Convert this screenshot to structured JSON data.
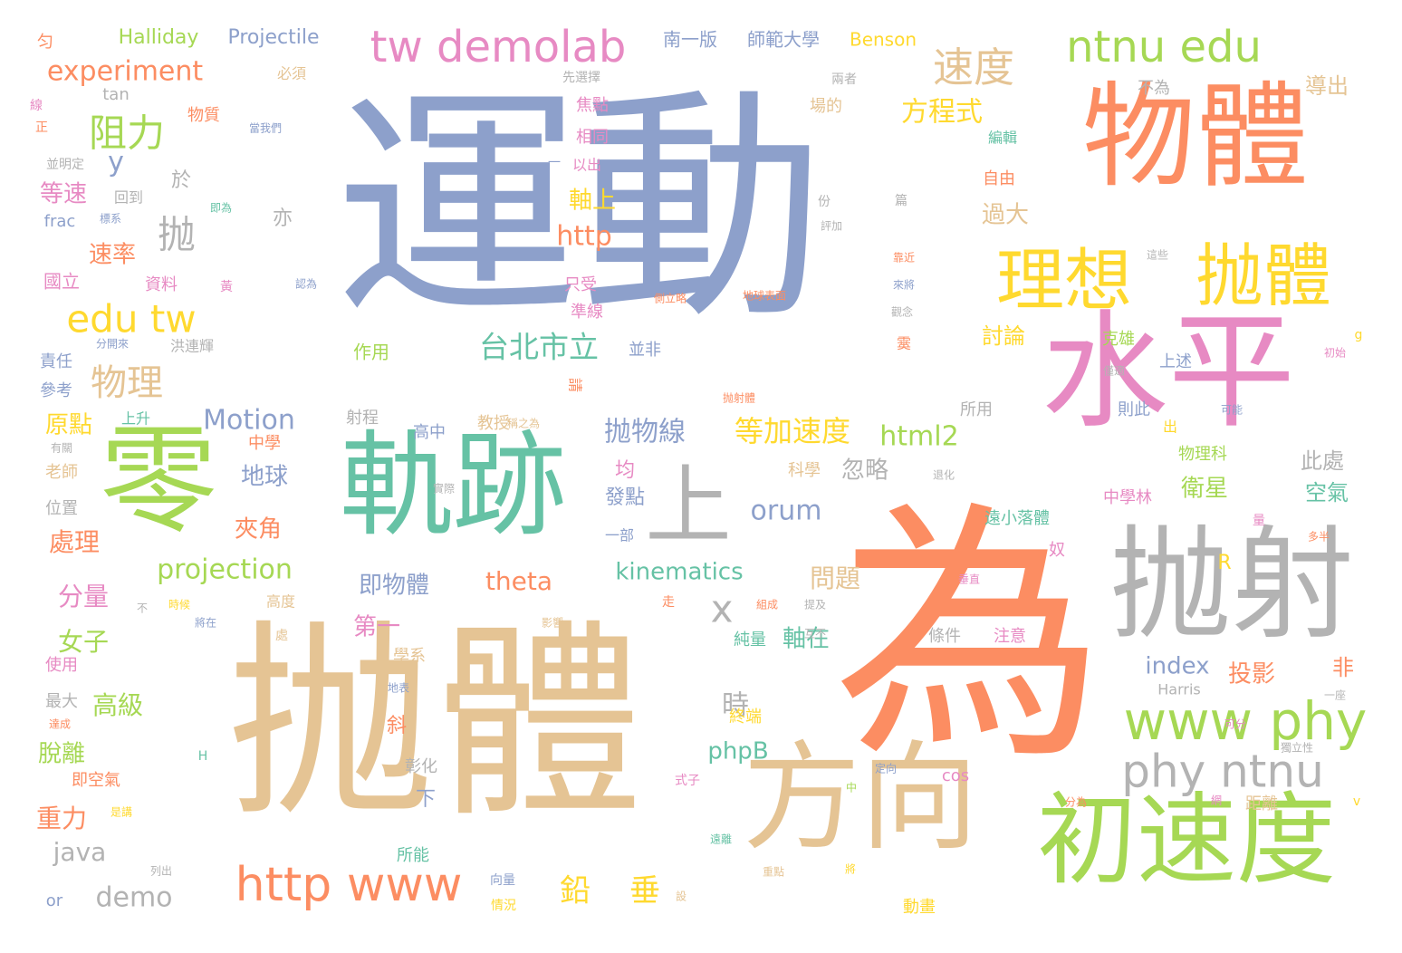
{
  "palette": {
    "blue": "#8da0cb",
    "orange": "#fc8d62",
    "tan": "#e5c494",
    "green": "#a6d854",
    "teal": "#66c2a5",
    "pink": "#e78ac3",
    "yellow": "#ffd92f",
    "gray": "#b3b3b3"
  },
  "words": [
    {
      "text": "運動",
      "color": "blue"
    },
    {
      "text": "為",
      "color": "orange"
    },
    {
      "text": "抛體",
      "color": "tan"
    },
    {
      "text": "物體",
      "color": "orange"
    },
    {
      "text": "水平",
      "color": "pink"
    },
    {
      "text": "軌跡",
      "color": "teal"
    },
    {
      "text": "零",
      "color": "green"
    },
    {
      "text": "抛射",
      "color": "gray"
    },
    {
      "text": "上",
      "color": "gray"
    },
    {
      "text": "方向",
      "color": "tan"
    },
    {
      "text": "初速度",
      "color": "green"
    },
    {
      "text": "理想",
      "color": "yellow"
    },
    {
      "text": "抛體",
      "color": "yellow"
    },
    {
      "text": "www phy",
      "color": "green"
    },
    {
      "text": "phy ntnu",
      "color": "gray"
    },
    {
      "text": "ntnu edu",
      "color": "green"
    },
    {
      "text": "tw demolab",
      "color": "pink"
    },
    {
      "text": "http www",
      "color": "orange"
    },
    {
      "text": "edu tw",
      "color": "yellow"
    },
    {
      "text": "速度",
      "color": "tan"
    },
    {
      "text": "阻力",
      "color": "green"
    },
    {
      "text": "物理",
      "color": "tan"
    },
    {
      "text": "台北市立",
      "color": "teal"
    },
    {
      "text": "抛物線",
      "color": "blue"
    },
    {
      "text": "等加速度",
      "color": "yellow"
    },
    {
      "text": "html2",
      "color": "green"
    },
    {
      "text": "Motion",
      "color": "blue"
    },
    {
      "text": "experiment",
      "color": "orange"
    },
    {
      "text": "projection",
      "color": "green"
    },
    {
      "text": "kinematics",
      "color": "teal"
    },
    {
      "text": "theta",
      "color": "orange"
    },
    {
      "text": "orum",
      "color": "blue"
    },
    {
      "text": "phpB",
      "color": "teal"
    },
    {
      "text": "index",
      "color": "blue"
    },
    {
      "text": "java",
      "color": "gray"
    },
    {
      "text": "demo",
      "color": "gray"
    },
    {
      "text": "http",
      "color": "orange"
    },
    {
      "text": "鉛",
      "color": "yellow"
    },
    {
      "text": "垂",
      "color": "yellow"
    },
    {
      "text": "x",
      "color": "gray"
    },
    {
      "text": "y",
      "color": "blue"
    },
    {
      "text": "時",
      "color": "gray"
    },
    {
      "text": "抛",
      "color": "gray"
    },
    {
      "text": "方程式",
      "color": "yellow"
    },
    {
      "text": "地球",
      "color": "blue"
    },
    {
      "text": "夾角",
      "color": "orange"
    },
    {
      "text": "分量",
      "color": "pink"
    },
    {
      "text": "女子",
      "color": "green"
    },
    {
      "text": "高級",
      "color": "green"
    },
    {
      "text": "脫離",
      "color": "green"
    },
    {
      "text": "重力",
      "color": "orange"
    },
    {
      "text": "處理",
      "color": "orange"
    },
    {
      "text": "原點",
      "color": "yellow"
    },
    {
      "text": "速率",
      "color": "orange"
    },
    {
      "text": "等速",
      "color": "pink"
    },
    {
      "text": "忽略",
      "color": "gray"
    },
    {
      "text": "衛星",
      "color": "green"
    },
    {
      "text": "空氣",
      "color": "teal"
    },
    {
      "text": "投影",
      "color": "orange"
    },
    {
      "text": "問題",
      "color": "tan"
    },
    {
      "text": "即物體",
      "color": "blue"
    },
    {
      "text": "第一",
      "color": "pink"
    },
    {
      "text": "軸在",
      "color": "teal"
    },
    {
      "text": "軸上",
      "color": "yellow"
    },
    {
      "text": "發點",
      "color": "blue"
    },
    {
      "text": "過大",
      "color": "tan"
    },
    {
      "text": "討論",
      "color": "yellow"
    },
    {
      "text": "導出",
      "color": "tan"
    },
    {
      "text": "此處",
      "color": "gray"
    },
    {
      "text": "南一版",
      "color": "blue"
    },
    {
      "text": "師範大學",
      "color": "blue"
    },
    {
      "text": "Benson",
      "color": "yellow"
    },
    {
      "text": "Halliday",
      "color": "green"
    },
    {
      "text": "Projectile",
      "color": "blue"
    },
    {
      "text": "於",
      "color": "gray"
    },
    {
      "text": "亦",
      "color": "gray"
    },
    {
      "text": "均",
      "color": "pink"
    },
    {
      "text": "非",
      "color": "orange"
    },
    {
      "text": "斜",
      "color": "orange"
    },
    {
      "text": "下",
      "color": "blue"
    },
    {
      "text": "R",
      "color": "yellow"
    },
    {
      "text": "國立",
      "color": "pink"
    },
    {
      "text": "資料",
      "color": "pink"
    },
    {
      "text": "參考",
      "color": "blue"
    },
    {
      "text": "責任",
      "color": "blue"
    },
    {
      "text": "老師",
      "color": "tan"
    },
    {
      "text": "位置",
      "color": "gray"
    },
    {
      "text": "使用",
      "color": "pink"
    },
    {
      "text": "最大",
      "color": "gray"
    },
    {
      "text": "物質",
      "color": "orange"
    },
    {
      "text": "焦點",
      "color": "pink"
    },
    {
      "text": "相同",
      "color": "pink"
    },
    {
      "text": "只受",
      "color": "pink"
    },
    {
      "text": "準線",
      "color": "pink"
    },
    {
      "text": "作用",
      "color": "green"
    },
    {
      "text": "並非",
      "color": "blue"
    },
    {
      "text": "射程",
      "color": "gray"
    },
    {
      "text": "高中",
      "color": "blue"
    },
    {
      "text": "教授",
      "color": "tan"
    },
    {
      "text": "中學",
      "color": "orange"
    },
    {
      "text": "科學",
      "color": "tan"
    },
    {
      "text": "中學林",
      "color": "pink"
    },
    {
      "text": "物理科",
      "color": "green"
    },
    {
      "text": "克雄",
      "color": "green"
    },
    {
      "text": "上述",
      "color": "blue"
    },
    {
      "text": "則此",
      "color": "blue"
    },
    {
      "text": "所用",
      "color": "gray"
    },
    {
      "text": "自由",
      "color": "orange"
    },
    {
      "text": "編輯",
      "color": "teal"
    },
    {
      "text": "場的",
      "color": "tan"
    },
    {
      "text": "不為",
      "color": "gray"
    },
    {
      "text": "條件",
      "color": "gray"
    },
    {
      "text": "注意",
      "color": "pink"
    },
    {
      "text": "終端",
      "color": "yellow"
    },
    {
      "text": "純量",
      "color": "teal"
    },
    {
      "text": "所能",
      "color": "teal"
    },
    {
      "text": "動畫",
      "color": "yellow"
    },
    {
      "text": "距離",
      "color": "tan"
    },
    {
      "text": "彰化",
      "color": "gray"
    },
    {
      "text": "學系",
      "color": "tan"
    },
    {
      "text": "即空氣",
      "color": "orange"
    },
    {
      "text": "高度",
      "color": "tan"
    },
    {
      "text": "上升",
      "color": "teal"
    },
    {
      "text": "洪連輝",
      "color": "gray"
    },
    {
      "text": "回到",
      "color": "gray"
    },
    {
      "text": "以出",
      "color": "pink"
    },
    {
      "text": "一部",
      "color": "blue"
    },
    {
      "text": "遠小落體",
      "color": "teal"
    },
    {
      "text": "Harris",
      "color": "gray"
    },
    {
      "text": "cos",
      "color": "pink"
    },
    {
      "text": "tan",
      "color": "gray"
    },
    {
      "text": "frac",
      "color": "blue"
    },
    {
      "text": "or",
      "color": "blue"
    },
    {
      "text": "匀",
      "color": "orange"
    },
    {
      "text": "必須",
      "color": "tan"
    },
    {
      "text": "先選擇",
      "color": "gray"
    },
    {
      "text": "兩者",
      "color": "gray"
    },
    {
      "text": "出",
      "color": "yellow"
    },
    {
      "text": "奴",
      "color": "pink"
    },
    {
      "text": "H",
      "color": "teal"
    },
    {
      "text": "g",
      "color": "yellow"
    },
    {
      "text": "v",
      "color": "yellow"
    },
    {
      "text": "黃",
      "color": "pink"
    },
    {
      "text": "正",
      "color": "orange"
    },
    {
      "text": "線",
      "color": "pink"
    },
    {
      "text": "份",
      "color": "gray"
    },
    {
      "text": "篇",
      "color": "gray"
    },
    {
      "text": "一",
      "color": "blue"
    },
    {
      "text": "走",
      "color": "orange"
    },
    {
      "text": "中",
      "color": "green"
    },
    {
      "text": "量",
      "color": "pink"
    },
    {
      "text": "霙",
      "color": "orange"
    },
    {
      "text": "處",
      "color": "tan"
    },
    {
      "text": "不",
      "color": "gray"
    },
    {
      "text": "網",
      "color": "pink"
    },
    {
      "text": "設",
      "color": "tan"
    },
    {
      "text": "將",
      "color": "yellow"
    },
    {
      "text": "並明定",
      "color": "gray"
    },
    {
      "text": "當我們",
      "color": "blue"
    },
    {
      "text": "即為",
      "color": "teal"
    },
    {
      "text": "標系",
      "color": "blue"
    },
    {
      "text": "評加",
      "color": "gray"
    },
    {
      "text": "認為",
      "color": "blue"
    },
    {
      "text": "分開來",
      "color": "blue"
    },
    {
      "text": "靠近",
      "color": "orange"
    },
    {
      "text": "來將",
      "color": "blue"
    },
    {
      "text": "觀念",
      "color": "gray"
    },
    {
      "text": "側立略",
      "color": "orange"
    },
    {
      "text": "地球表面",
      "color": "orange"
    },
    {
      "text": "抛射體",
      "color": "orange"
    },
    {
      "text": "稱之為",
      "color": "tan"
    },
    {
      "text": "僅適",
      "color": "gray"
    },
    {
      "text": "這些",
      "color": "gray"
    },
    {
      "text": "初始",
      "color": "pink"
    },
    {
      "text": "可能",
      "color": "blue"
    },
    {
      "text": "退化",
      "color": "gray"
    },
    {
      "text": "實際",
      "color": "gray"
    },
    {
      "text": "有關",
      "color": "gray"
    },
    {
      "text": "時候",
      "color": "yellow"
    },
    {
      "text": "將在",
      "color": "blue"
    },
    {
      "text": "組成",
      "color": "orange"
    },
    {
      "text": "提及",
      "color": "gray"
    },
    {
      "text": "影響",
      "color": "tan"
    },
    {
      "text": "互不",
      "color": "gray"
    },
    {
      "text": "垂直",
      "color": "pink"
    },
    {
      "text": "多半",
      "color": "orange"
    },
    {
      "text": "地表",
      "color": "blue"
    },
    {
      "text": "達成",
      "color": "orange"
    },
    {
      "text": "一座",
      "color": "gray"
    },
    {
      "text": "可分",
      "color": "pink"
    },
    {
      "text": "獨立性",
      "color": "gray"
    },
    {
      "text": "定向",
      "color": "blue"
    },
    {
      "text": "分為",
      "color": "orange"
    },
    {
      "text": "是講",
      "color": "yellow"
    },
    {
      "text": "列出",
      "color": "gray"
    },
    {
      "text": "遠離",
      "color": "teal"
    },
    {
      "text": "重點",
      "color": "tan"
    },
    {
      "text": "向量",
      "color": "blue"
    },
    {
      "text": "情況",
      "color": "yellow"
    },
    {
      "text": "式子",
      "color": "pink"
    },
    {
      "text": "請",
      "color": "orange"
    }
  ]
}
